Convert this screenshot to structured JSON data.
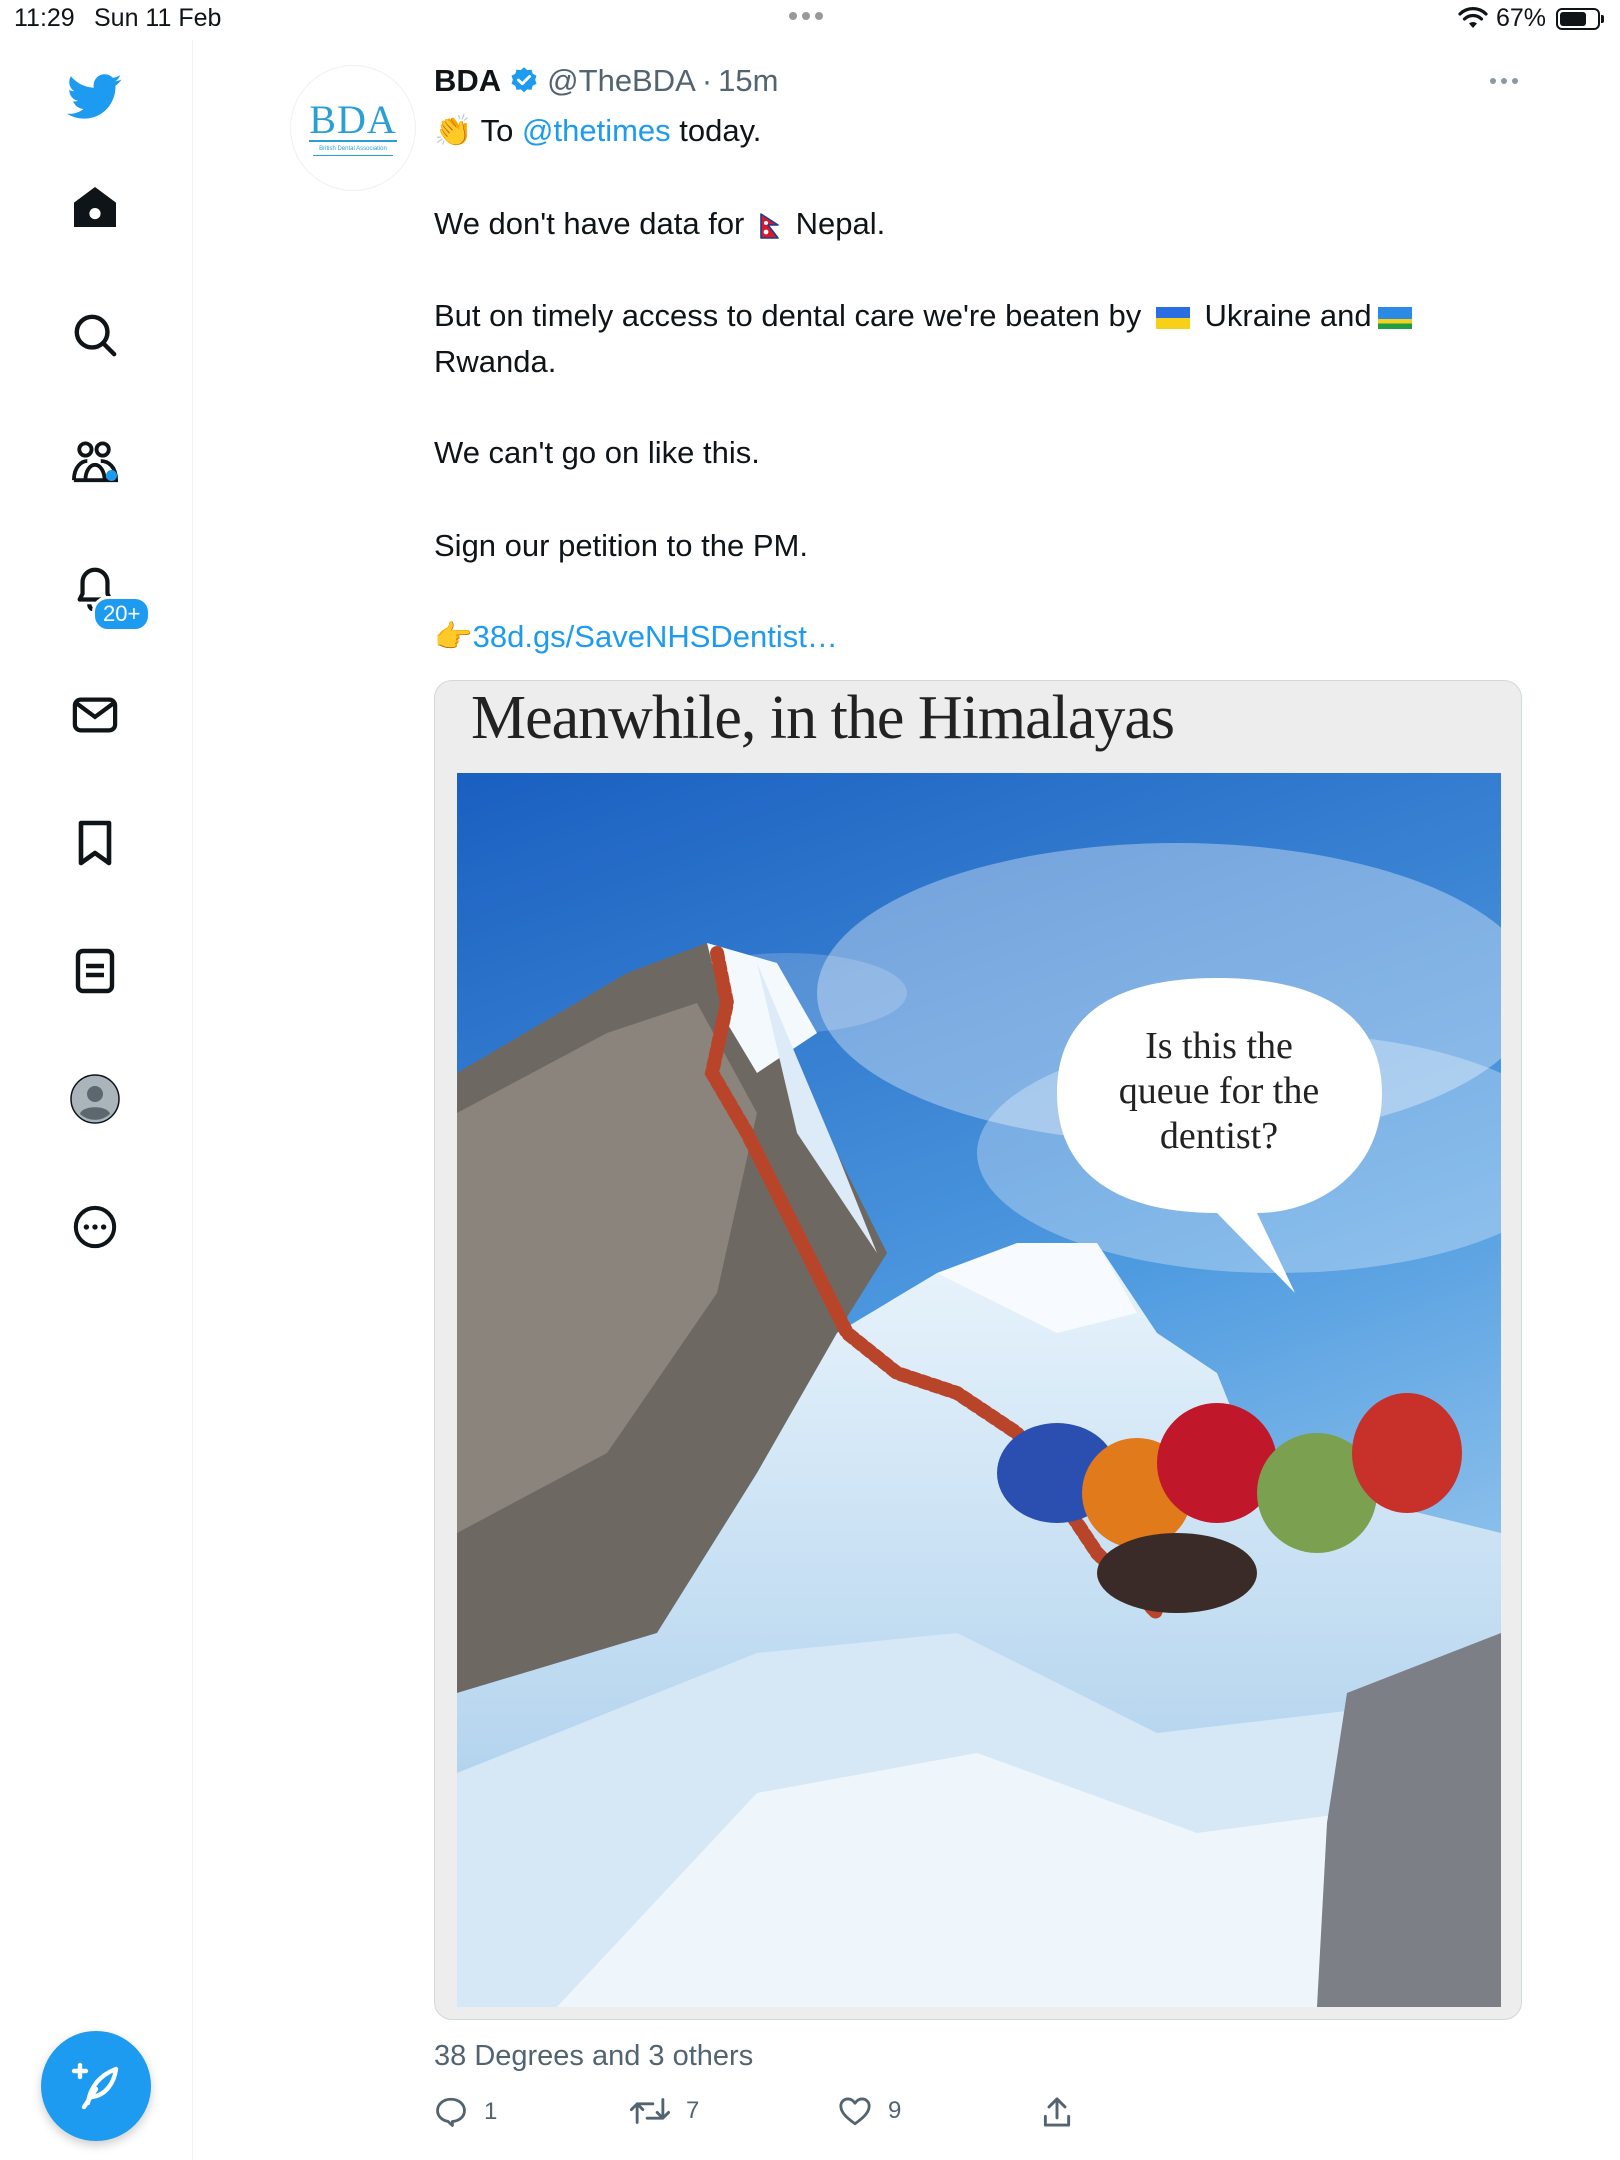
{
  "status_bar": {
    "time": "11:29",
    "date": "Sun 11 Feb",
    "battery": "67%"
  },
  "sidebar": {
    "items": [
      {
        "icon": "twitter-logo-icon"
      },
      {
        "icon": "home-icon"
      },
      {
        "icon": "search-icon"
      },
      {
        "icon": "communities-icon"
      },
      {
        "icon": "notifications-icon",
        "badge": "20+"
      },
      {
        "icon": "messages-icon"
      },
      {
        "icon": "bookmarks-icon"
      },
      {
        "icon": "lists-icon"
      },
      {
        "icon": "profile-icon"
      },
      {
        "icon": "more-icon"
      }
    ],
    "compose_icon": "compose-icon"
  },
  "tweet": {
    "avatar": {
      "abbr": "BDA",
      "subtitle": "British Dental Association"
    },
    "name": "BDA",
    "handle": "@TheBDA",
    "separator": "·",
    "time": "15m",
    "line1_emoji": "👏",
    "line1_pre": " To ",
    "line1_mention": "@thetimes",
    "line1_post": " today.",
    "line2_pre": "We don't have data for ",
    "line2_post": " Nepal.",
    "line3_pre": "But on timely  access to dental care we're beaten by ",
    "line3_mid": " Ukraine and",
    "line3_end": "Rwanda.",
    "line4": "We can't go on like this.",
    "line5": "Sign our petition to the PM.",
    "link_emoji": "👉",
    "link_text": "38d.gs/SaveNHSDentist…",
    "media": {
      "headline": "Meanwhile, in the Himalayas",
      "bubble_lines": [
        "Is this the",
        "queue for the",
        "dentist?"
      ]
    },
    "likers": "38 Degrees and 3 others",
    "actions": {
      "replies": "1",
      "retweets": "7",
      "likes": "9"
    }
  },
  "colors": {
    "accent": "#1d9bf0",
    "text": "#0f1419",
    "muted": "#536471"
  }
}
